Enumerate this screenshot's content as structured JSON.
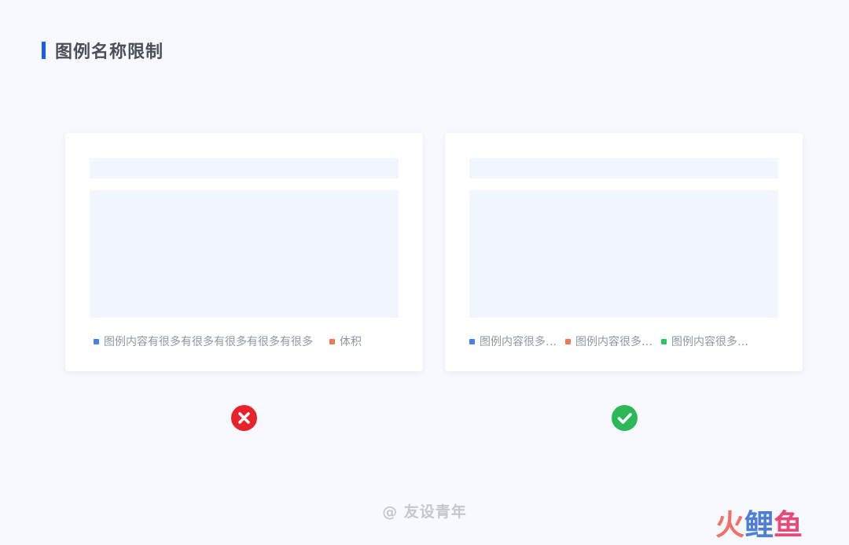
{
  "page": {
    "title": "图例名称限制",
    "accent_color": "#1a5cf2"
  },
  "cards": {
    "bad": {
      "legend": [
        {
          "label": "图例内容有很多有很多有很多有很多有很多",
          "color": "#4a7fe5"
        },
        {
          "label": "体积",
          "color": "#ec7a58"
        }
      ],
      "status_icon": "cross-circle-icon",
      "status_color": "#e8222b"
    },
    "good": {
      "legend": [
        {
          "label": "图例内容很多…",
          "color": "#4a7fe5"
        },
        {
          "label": "图例内容很多…",
          "color": "#ec7a58"
        },
        {
          "label": "图例内容很多…",
          "color": "#2bc469"
        }
      ],
      "status_icon": "check-circle-icon",
      "status_color": "#2bb958"
    }
  },
  "watermark": "@ 友设青年",
  "logo": [
    "火",
    "鲤",
    "鱼"
  ]
}
